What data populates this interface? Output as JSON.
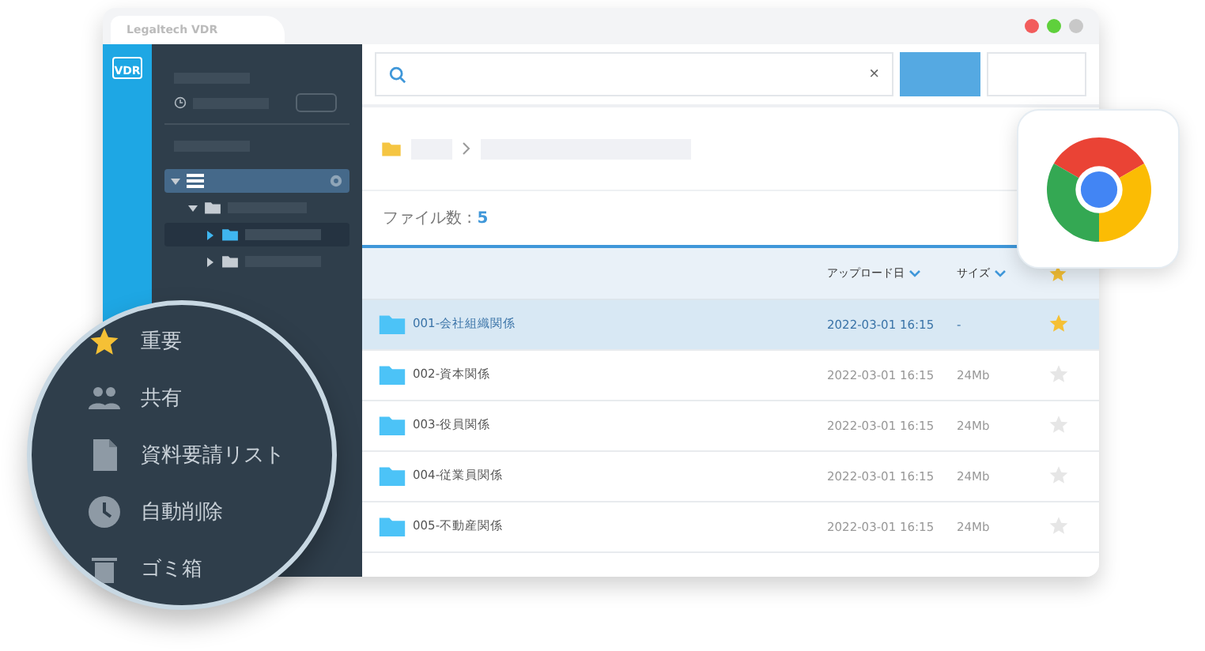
{
  "window": {
    "title": "Legaltech VDR",
    "logo": "VDR"
  },
  "sidebar": {
    "tree": [
      {
        "expanded": true,
        "selected": false,
        "children": [
          {
            "expanded": true,
            "selected": false,
            "children": [
              {
                "expanded": false,
                "selected": true
              },
              {
                "expanded": false,
                "selected": false
              }
            ]
          }
        ]
      }
    ]
  },
  "search": {
    "clear": "×"
  },
  "file_count": {
    "label": "ファイル数 : ",
    "value": "5"
  },
  "table": {
    "columns": [
      "アップロード日",
      "サイズ"
    ],
    "rows": [
      {
        "name": "001-会社組織関係",
        "date": "2022-03-01 16:15",
        "size": "-",
        "starred": true,
        "selected": true
      },
      {
        "name": "002-資本関係",
        "date": "2022-03-01 16:15",
        "size": "24Mb",
        "starred": false,
        "selected": false
      },
      {
        "name": "003-役員関係",
        "date": "2022-03-01 16:15",
        "size": "24Mb",
        "starred": false,
        "selected": false
      },
      {
        "name": "004-従業員関係",
        "date": "2022-03-01 16:15",
        "size": "24Mb",
        "starred": false,
        "selected": false
      },
      {
        "name": "005-不動産関係",
        "date": "2022-03-01 16:15",
        "size": "24Mb",
        "starred": false,
        "selected": false
      }
    ]
  },
  "magnifier": {
    "items": [
      {
        "kind": "star",
        "label": "重要"
      },
      {
        "kind": "people",
        "label": "共有"
      },
      {
        "kind": "document",
        "label": "資料要請リスト"
      },
      {
        "kind": "clock",
        "label": "自動削除"
      },
      {
        "kind": "trash",
        "label": "ゴミ箱"
      }
    ]
  }
}
